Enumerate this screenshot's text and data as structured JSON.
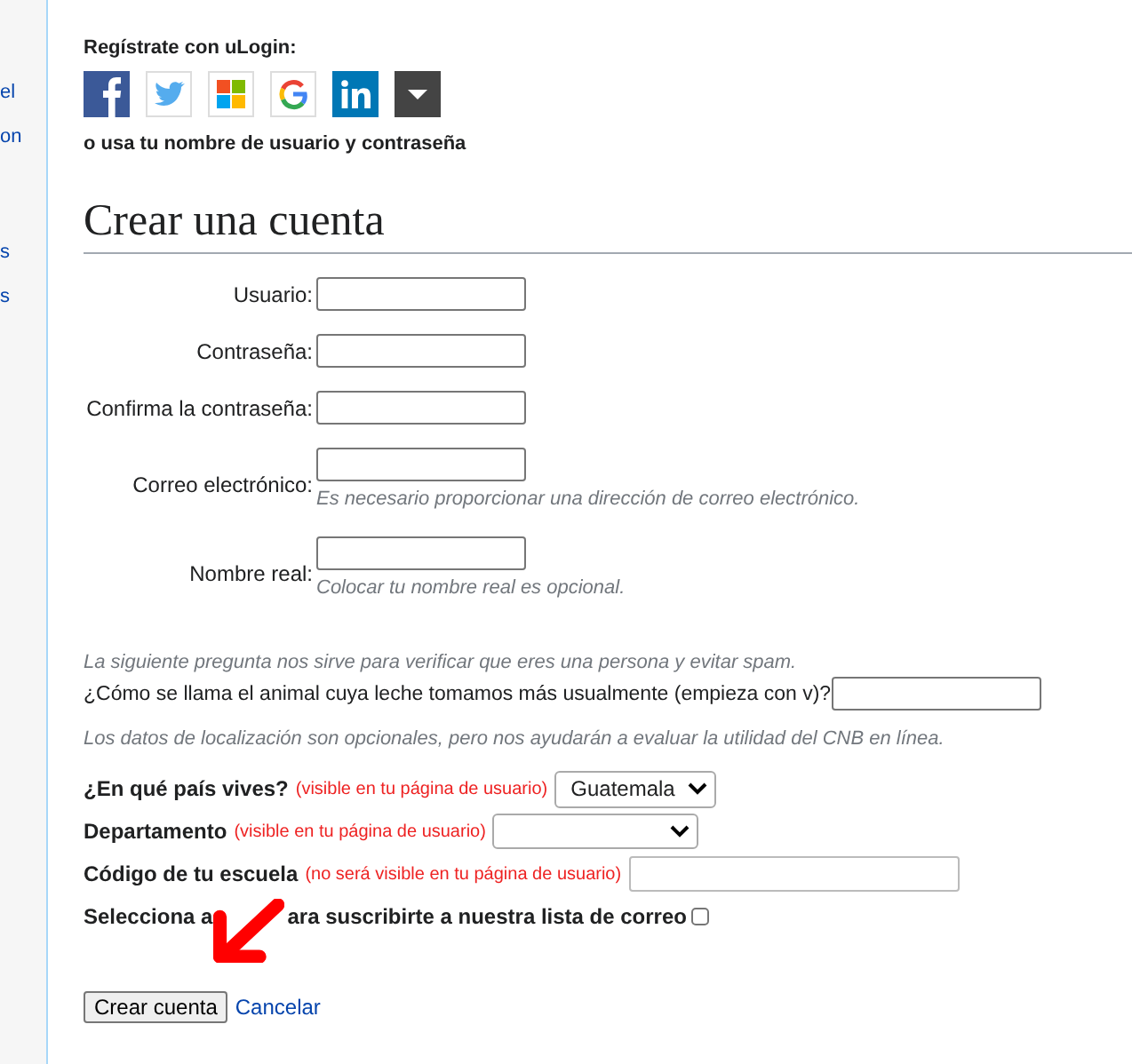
{
  "sidebar": {
    "groups": [
      [
        "el",
        "on"
      ],
      [
        "s",
        "s"
      ]
    ]
  },
  "ulogin": {
    "title": "Regístrate con uLogin:",
    "providers": [
      {
        "kind": "facebook"
      },
      {
        "kind": "twitter"
      },
      {
        "kind": "microsoft"
      },
      {
        "kind": "google"
      },
      {
        "kind": "linkedin"
      },
      {
        "kind": "more"
      }
    ],
    "alt_text": "o usa tu nombre de usuario y contraseña"
  },
  "heading": "Crear una cuenta",
  "fields": [
    {
      "label": "Usuario:"
    },
    {
      "label": "Contraseña:"
    },
    {
      "label": "Confirma la contraseña:"
    },
    {
      "label": "Correo electrónico:",
      "hint": "Es necesario proporcionar una dirección de correo electrónico."
    },
    {
      "label": "Nombre real:",
      "hint": "Colocar tu nombre real es opcional."
    }
  ],
  "spam_note": "La siguiente pregunta nos sirve para verificar que eres una persona y evitar spam.",
  "question": "¿Cómo se llama el animal cuya leche tomamos más usualmente (empieza con v)?",
  "location_note": "Los datos de localización son opcionales, pero nos ayudarán a evaluar la utilidad del CNB en línea.",
  "location": [
    {
      "kind": "select",
      "label": "¿En qué país vives?",
      "note": "(visible en tu página de usuario)",
      "value": "Guatemala"
    },
    {
      "kind": "select",
      "label": "Departamento",
      "note": "(visible en tu página de usuario)"
    },
    {
      "kind": "text",
      "label": "Código de tu escuela",
      "note": "(no será visible en tu página de usuario)"
    }
  ],
  "mailing": {
    "label_start": "Selecciona a",
    "label_end": "ara suscribirte a nuestra lista de correo",
    "checked": false
  },
  "buttons": {
    "submit": "Crear cuenta",
    "cancel": "Cancelar"
  }
}
